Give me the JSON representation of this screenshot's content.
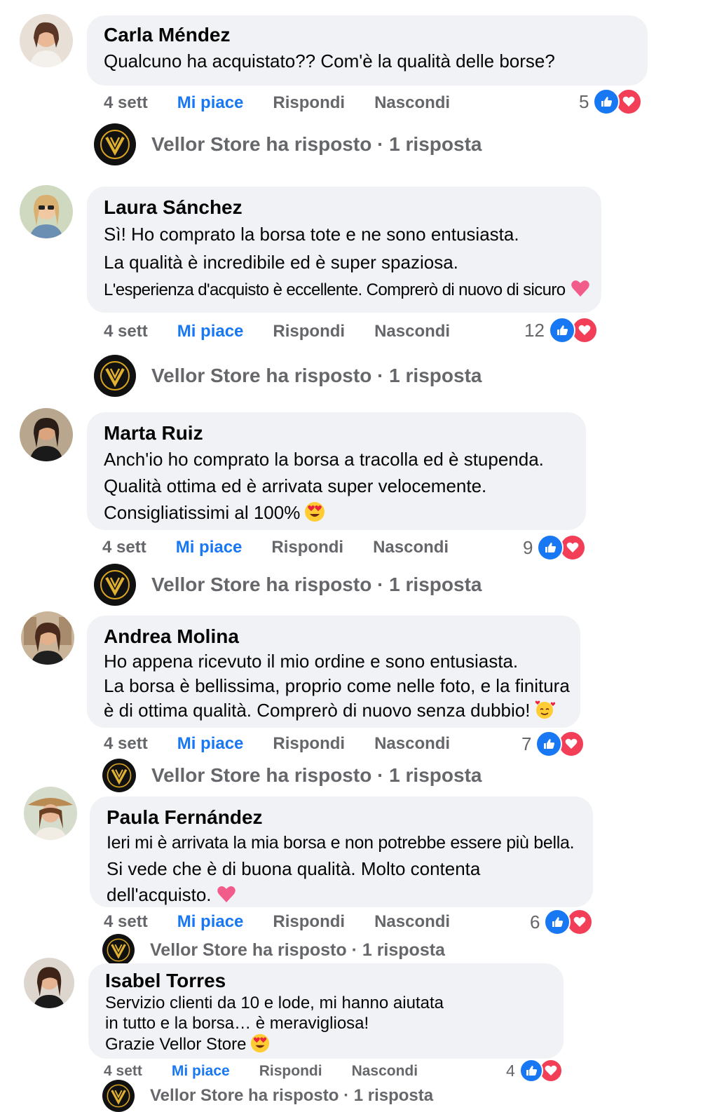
{
  "comments": [
    {
      "author": "Carla Méndez",
      "lines": [
        "Qualcuno ha acquistato?? Com'è la qualità delle borse?"
      ],
      "time": "4 sett",
      "like": "Mi piace",
      "reply": "Rispondi",
      "hide": "Nascondi",
      "count": "5",
      "reply_summary": "Vellor Store ha risposto · 1 risposta",
      "emoji": ""
    },
    {
      "author": "Laura Sánchez",
      "lines": [
        "Sì! Ho comprato la borsa tote e ne sono entusiasta.",
        "La qualità è incredibile ed è super spaziosa.",
        "L'esperienza d'acquisto è eccellente. Comprerò di nuovo di sicuro"
      ],
      "time": "4 sett",
      "like": "Mi piace",
      "reply": "Rispondi",
      "hide": "Nascondi",
      "count": "12",
      "reply_summary": "Vellor Store ha risposto · 1 risposta",
      "emoji": "heart"
    },
    {
      "author": "Marta Ruiz",
      "lines": [
        "Anch'io ho comprato la borsa a tracolla ed è stupenda.",
        "Qualità ottima ed è arrivata super velocemente.",
        "Consigliatissimi al 100%"
      ],
      "time": "4 sett",
      "like": "Mi piace",
      "reply": "Rispondi",
      "hide": "Nascondi",
      "count": "9",
      "reply_summary": "Vellor Store ha risposto · 1 risposta",
      "emoji": "heart-eyes"
    },
    {
      "author": "Andrea Molina",
      "lines": [
        "Ho appena ricevuto il mio ordine e sono entusiasta.",
        "La borsa è bellissima, proprio come nelle foto, e la finitura",
        "è di ottima qualità. Comprerò di nuovo senza dubbio!"
      ],
      "time": "4 sett",
      "like": "Mi piace",
      "reply": "Rispondi",
      "hide": "Nascondi",
      "count": "7",
      "reply_summary": "Vellor Store ha risposto · 1 risposta",
      "emoji": "smiling-hearts"
    },
    {
      "author": "Paula Fernández",
      "lines": [
        "Ieri mi è arrivata la mia borsa e non potrebbe essere più bella.",
        "Si vede che è di buona qualità. Molto contenta",
        "dell'acquisto."
      ],
      "time": "4 sett",
      "like": "Mi piace",
      "reply": "Rispondi",
      "hide": "Nascondi",
      "count": "6",
      "reply_summary": "Vellor Store ha risposto · 1 risposta",
      "emoji": "heart"
    },
    {
      "author": "Isabel Torres",
      "lines": [
        "Servizio clienti da 10 e lode, mi hanno aiutata",
        "in tutto e la borsa… è meravigliosa!",
        "Grazie Vellor Store"
      ],
      "time": "4 sett",
      "like": "Mi piace",
      "reply": "Rispondi",
      "hide": "Nascondi",
      "count": "4",
      "reply_summary": "Vellor Store ha risposto · 1 risposta",
      "emoji": "heart-eyes"
    }
  ],
  "colors": {
    "like_blue": "#1877f2",
    "heart_red": "#f33e58",
    "bubble": "#f0f2f5",
    "muted": "#65676b"
  },
  "icons": {
    "like": "thumbs-up-icon",
    "love": "heart-icon",
    "store": "vellor-store-logo"
  }
}
